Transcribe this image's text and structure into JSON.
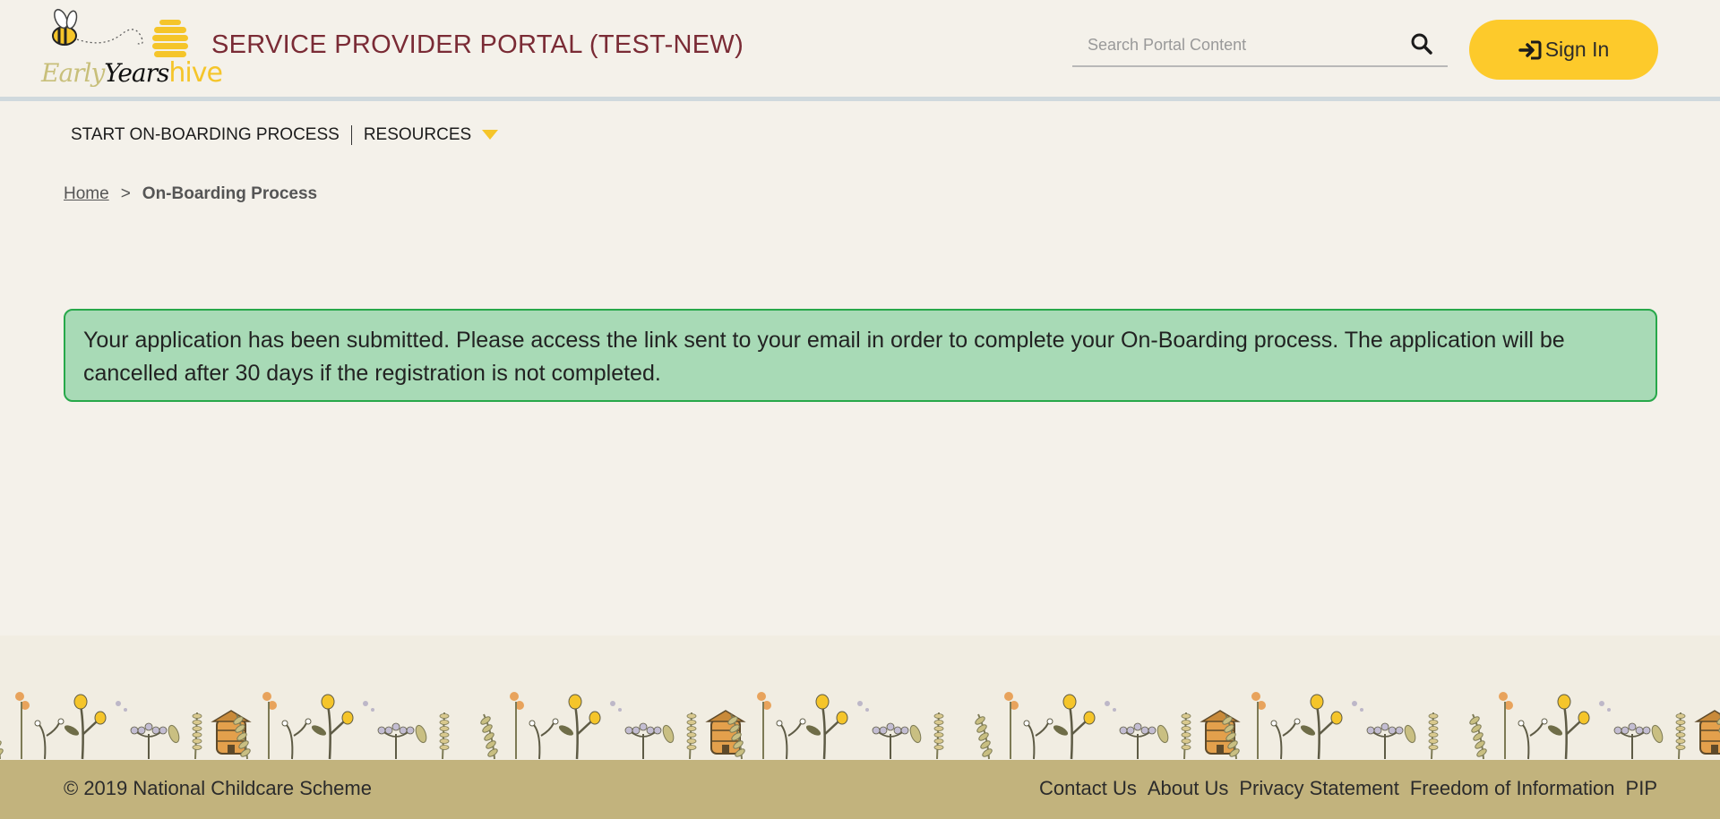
{
  "header": {
    "logo": {
      "word1": "Early",
      "word2": "Years",
      "word3": "hive"
    },
    "title": "SERVICE PROVIDER PORTAL (TEST-NEW)",
    "search": {
      "placeholder": "Search Portal Content",
      "icon": "search-icon"
    },
    "signin": {
      "label": "Sign In",
      "icon": "sign-in-icon"
    }
  },
  "nav": {
    "items": [
      {
        "label": "START ON-BOARDING PROCESS"
      },
      {
        "label": "RESOURCES",
        "icon": "chevron-down-icon"
      }
    ]
  },
  "breadcrumb": {
    "home": "Home",
    "separator": ">",
    "current": "On-Boarding Process"
  },
  "alert": {
    "message": "Your application has been submitted. Please access the link sent to your email in order to complete your On-Boarding process. The application will be cancelled after 30 days if the registration is not completed."
  },
  "footer": {
    "copyright": "© 2019 National Childcare Scheme",
    "links": [
      "Contact Us",
      "About Us",
      "Privacy Statement",
      "Freedom of Information",
      "PIP"
    ]
  },
  "colors": {
    "background": "#f4f1ea",
    "title": "#7a2b35",
    "signin_button": "#fdca2b",
    "alert_bg": "#a8dab6",
    "alert_border": "#27a84a",
    "footer_bg": "#c2b37d"
  }
}
